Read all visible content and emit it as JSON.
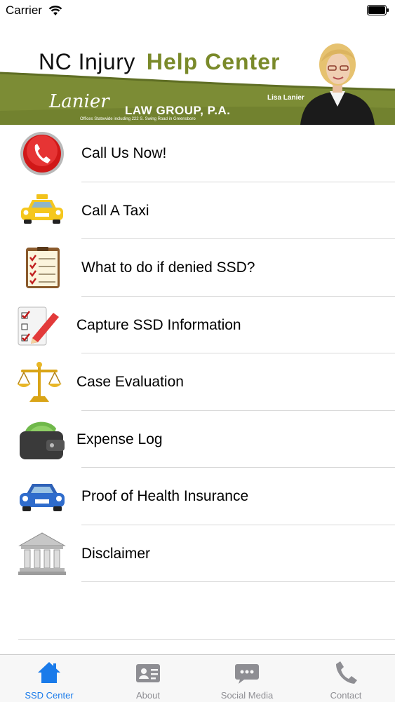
{
  "status_bar": {
    "carrier": "Carrier"
  },
  "banner": {
    "title_part1": "NC Injury",
    "title_part2": "Help Center",
    "firm_script": "Lanier",
    "firm_name": "LAW GROUP, P.A.",
    "firm_subtitle": "Offices Statewide including 222 S. Swing Road in Greensboro",
    "attorney_name": "Lisa Lanier",
    "brand_color": "#7a8a2a"
  },
  "menu": {
    "items": [
      {
        "label": "Call Us Now!",
        "icon": "phone-icon"
      },
      {
        "label": "Call A Taxi",
        "icon": "taxi-icon"
      },
      {
        "label": "What to do if denied SSD?",
        "icon": "checklist-icon"
      },
      {
        "label": "Capture SSD Information",
        "icon": "form-pencil-icon"
      },
      {
        "label": "Case Evaluation",
        "icon": "scales-icon"
      },
      {
        "label": "Expense Log",
        "icon": "wallet-icon"
      },
      {
        "label": "Proof of Health Insurance",
        "icon": "car-icon"
      },
      {
        "label": "Disclaimer",
        "icon": "courthouse-icon"
      }
    ]
  },
  "tab_bar": {
    "active_color": "#1a7bea",
    "tabs": [
      {
        "label": "SSD Center",
        "icon": "home-icon",
        "active": true
      },
      {
        "label": "About",
        "icon": "id-card-icon",
        "active": false
      },
      {
        "label": "Social Media",
        "icon": "chat-bubble-icon",
        "active": false
      },
      {
        "label": "Contact",
        "icon": "phone-handset-icon",
        "active": false
      }
    ]
  }
}
